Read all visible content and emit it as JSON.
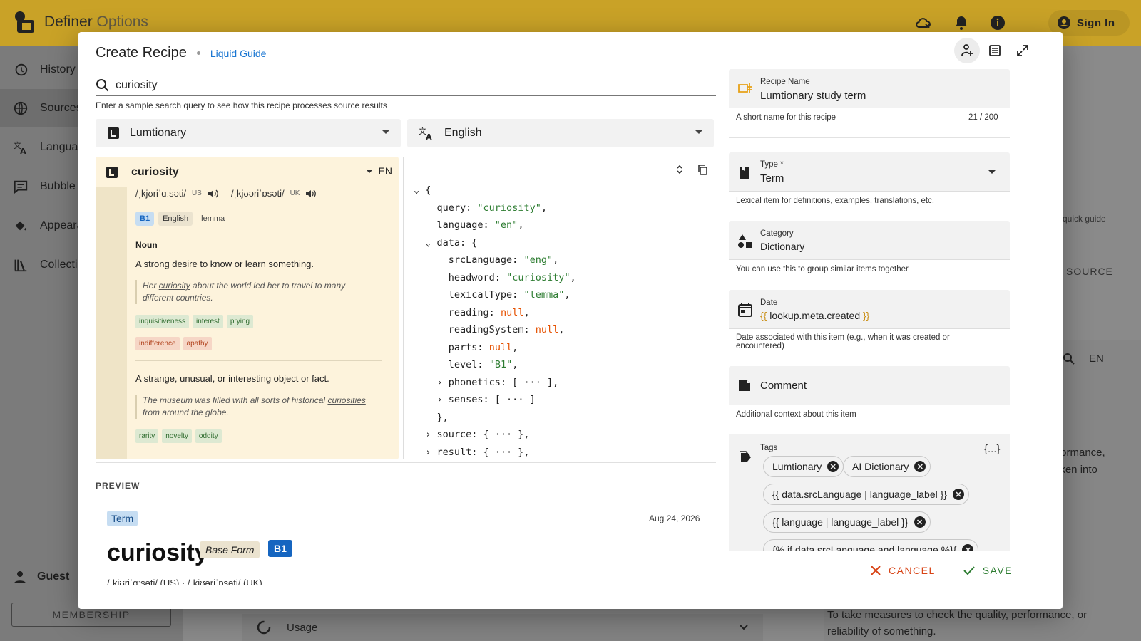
{
  "app": {
    "title_a": "Definer",
    "title_b": "Options",
    "sign_in": "Sign In"
  },
  "drawer": {
    "items": [
      {
        "label": "History",
        "icon": "history-icon"
      },
      {
        "label": "Sources",
        "icon": "globe-icon"
      },
      {
        "label": "Languag",
        "icon": "translate-icon"
      },
      {
        "label": "Bubble",
        "icon": "chat-icon"
      },
      {
        "label": "Appeara",
        "icon": "paint-icon"
      },
      {
        "label": "Collecti",
        "icon": "library-icon"
      }
    ],
    "guest": "Guest",
    "membership": "MEMBERSHIP"
  },
  "background": {
    "quick_guide": "quick guide",
    "source": "SOURCE",
    "en": "EN",
    "text_right": "rformance,\naken into",
    "text_bottom": "To take measures to check the quality, performance, or reliability of something.",
    "usage": "Usage"
  },
  "dialog": {
    "title": "Create Recipe",
    "guide": "Liquid Guide",
    "search_value": "curiosity",
    "search_help": "Enter a sample search query to see how this recipe processes source results",
    "source_select": "Lumtionary",
    "language_select": "English"
  },
  "entry": {
    "headword": "curiosity",
    "lang": "EN",
    "phon_us": "/ˌkjʊriˈɑːsəti/",
    "phon_us_tag": "US",
    "phon_uk": "/ˌkjʊəriˈɒsəti/",
    "phon_uk_tag": "UK",
    "level": "B1",
    "language": "English",
    "lexical": "lemma",
    "pos": "Noun",
    "sense1": "A strong desire to know or learn something.",
    "ex1_a": "Her ",
    "ex1_u": "curiosity",
    "ex1_b": " about the world led her to travel to many different countries.",
    "syn1": [
      "inquisitiveness",
      "interest",
      "prying"
    ],
    "ant1": [
      "indifference",
      "apathy"
    ],
    "sense2": "A strange, unusual, or interesting object or fact.",
    "ex2_a": "The museum was filled with all sorts of historical ",
    "ex2_u": "curiosities",
    "ex2_b": " from around the globe.",
    "syn2": [
      "rarity",
      "novelty",
      "oddity"
    ]
  },
  "code": {
    "l1": "{",
    "l2k": "query: ",
    "l2v": "\"curiosity\"",
    "l3k": "language: ",
    "l3v": "\"en\"",
    "l4": "data: {",
    "l5k": "srcLanguage: ",
    "l5v": "\"eng\"",
    "l6k": "headword: ",
    "l6v": "\"curiosity\"",
    "l7k": "lexicalType: ",
    "l7v": "\"lemma\"",
    "l8k": "reading: ",
    "l8v": "null",
    "l9k": "readingSystem: ",
    "l9v": "null",
    "l10k": "parts: ",
    "l10v": "null",
    "l11k": "level: ",
    "l11v": "\"B1\"",
    "l12": "phonetics: [ ··· ],",
    "l13": "senses: [ ··· ]",
    "l14": "},",
    "l15": "source: { ··· },",
    "l16": "result: { ··· },"
  },
  "preview": {
    "label": "PREVIEW",
    "type": "Term",
    "date": "Aug 24, 2026",
    "headword": "curiosity",
    "form": "Base Form",
    "level": "B1",
    "phon": "/ˌkjʊriˈɑːsəti/ (US)  ·  /ˌkjʊəriˈɒsəti/ (UK)"
  },
  "form": {
    "name_label": "Recipe Name",
    "name_value": "Lumtionary study term",
    "name_hint": "A short name for this recipe",
    "name_count": "21 / 200",
    "type_label": "Type *",
    "type_value": "Term",
    "type_hint": "Lexical item for definitions, examples, translations, etc.",
    "cat_label": "Category",
    "cat_value": "Dictionary",
    "cat_hint": "You can use this to group similar items together",
    "date_label": "Date",
    "date_open": "{{",
    "date_value": " lookup.meta.created ",
    "date_close": "}}",
    "date_hint": "Date associated with this item (e.g., when it was created or encountered)",
    "comment_label": "Comment",
    "comment_hint": "Additional context about this item",
    "tags_label": "Tags",
    "tags_code": "{...}",
    "tags": [
      "Lumtionary",
      "AI Dictionary",
      "{{ data.srcLanguage | language_label }}",
      "{{ language | language_label }}",
      "{% if data.srcLanguage and language %}{"
    ],
    "cancel": "CANCEL",
    "save": "SAVE"
  },
  "colors": {
    "accent": "#c9a227",
    "link": "#1976d2",
    "cancel": "#d84315",
    "save": "#2e7d32"
  }
}
